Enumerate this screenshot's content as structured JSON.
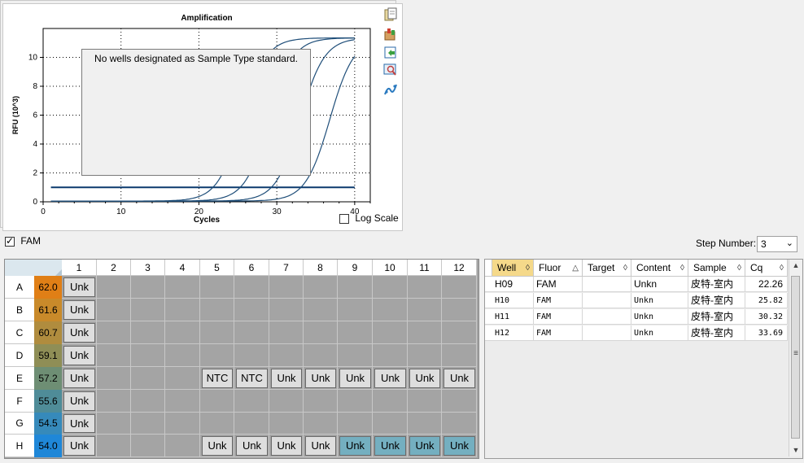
{
  "chart_panel": {
    "toolbar_icons": [
      "copy-icon",
      "export-icon",
      "save-image-icon",
      "zoom-icon",
      "trace-styles-icon"
    ],
    "log_scale_label": "Log Scale",
    "log_scale_checked": false
  },
  "chart_data": {
    "type": "line",
    "title": "Amplification",
    "xlabel": "Cycles",
    "ylabel": "RFU (10^3)",
    "xlim": [
      0,
      42
    ],
    "ylim": [
      0,
      12
    ],
    "xticks": [
      "0",
      "10",
      "20",
      "30",
      "40"
    ],
    "yticks": [
      "0",
      "2",
      "4",
      "6",
      "8",
      "10"
    ],
    "grid": true,
    "threshold": 1.0,
    "series_color": "#1f4e79",
    "threshold_color": "#0b3a6e",
    "series": [
      {
        "midpoint": 25.5,
        "plateau": 11.3,
        "slope": 1.55
      },
      {
        "midpoint": 29.0,
        "plateau": 11.3,
        "slope": 1.55
      },
      {
        "midpoint": 33.0,
        "plateau": 11.3,
        "slope": 1.55
      },
      {
        "midpoint": 36.8,
        "plateau": 11.3,
        "slope": 1.55
      }
    ]
  },
  "standard_curve": {
    "message": "No wells designated as Sample Type standard."
  },
  "fluor_filter": {
    "label": "FAM",
    "checked": true
  },
  "step": {
    "label": "Step Number:",
    "value": "3"
  },
  "plate": {
    "columns": [
      "1",
      "2",
      "3",
      "4",
      "5",
      "6",
      "7",
      "8",
      "9",
      "10",
      "11",
      "12"
    ],
    "rows": [
      {
        "label": "A",
        "temp": "62.0",
        "color": "#e07f16",
        "wells": {
          "1": "Unk"
        }
      },
      {
        "label": "B",
        "temp": "61.6",
        "color": "#c98a2a",
        "wells": {
          "1": "Unk"
        }
      },
      {
        "label": "C",
        "temp": "60.7",
        "color": "#b08c3e",
        "wells": {
          "1": "Unk"
        }
      },
      {
        "label": "D",
        "temp": "59.1",
        "color": "#8f8e56",
        "wells": {
          "1": "Unk"
        }
      },
      {
        "label": "E",
        "temp": "57.2",
        "color": "#6e8e74",
        "wells": {
          "1": "Unk",
          "5": "NTC",
          "6": "NTC",
          "7": "Unk",
          "8": "Unk",
          "9": "Unk",
          "10": "Unk",
          "11": "Unk",
          "12": "Unk"
        }
      },
      {
        "label": "F",
        "temp": "55.6",
        "color": "#4f8c98",
        "wells": {
          "1": "Unk"
        }
      },
      {
        "label": "G",
        "temp": "54.5",
        "color": "#368abb",
        "wells": {
          "1": "Unk"
        }
      },
      {
        "label": "H",
        "temp": "54.0",
        "color": "#1f87d8",
        "wells": {
          "1": "Unk",
          "5": "Unk",
          "6": "Unk",
          "7": "Unk",
          "8": "Unk",
          "9": "Unk",
          "10": "Unk",
          "11": "Unk",
          "12": "Unk"
        },
        "selected": [
          "9",
          "10",
          "11",
          "12"
        ]
      }
    ]
  },
  "results_table": {
    "columns": [
      "Well",
      "Fluor",
      "Target",
      "Content",
      "Sample",
      "Cq"
    ],
    "sort_marks": [
      "◊",
      "△",
      "◊",
      "◊",
      "◊",
      "◊"
    ],
    "rows": [
      {
        "well": "H09",
        "fluor": "FAM",
        "target": "",
        "content": "Unkn",
        "sample": "皮特-室内",
        "cq": "22.26",
        "mono": false
      },
      {
        "well": "H10",
        "fluor": "FAM",
        "target": "",
        "content": "Unkn",
        "sample": "皮特-室内",
        "cq": "25.82",
        "mono": true
      },
      {
        "well": "H11",
        "fluor": "FAM",
        "target": "",
        "content": "Unkn",
        "sample": "皮特-室内",
        "cq": "30.32",
        "mono": true
      },
      {
        "well": "H12",
        "fluor": "FAM",
        "target": "",
        "content": "Unkn",
        "sample": "皮特-室内",
        "cq": "33.69",
        "mono": true
      }
    ]
  }
}
